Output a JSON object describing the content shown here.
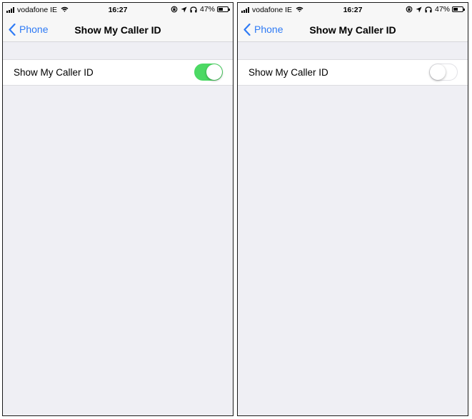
{
  "colors": {
    "accent": "#2f7bf5",
    "toggle_on": "#4cd964",
    "background": "#efeff4"
  },
  "screens": [
    {
      "status_bar": {
        "carrier": "vodafone IE",
        "time": "16:27",
        "battery": "47%"
      },
      "nav": {
        "back_label": "Phone",
        "title": "Show My Caller ID"
      },
      "setting": {
        "label": "Show My Caller ID",
        "state": "on"
      }
    },
    {
      "status_bar": {
        "carrier": "vodafone IE",
        "time": "16:27",
        "battery": "47%"
      },
      "nav": {
        "back_label": "Phone",
        "title": "Show My Caller ID"
      },
      "setting": {
        "label": "Show My Caller ID",
        "state": "off"
      }
    }
  ]
}
